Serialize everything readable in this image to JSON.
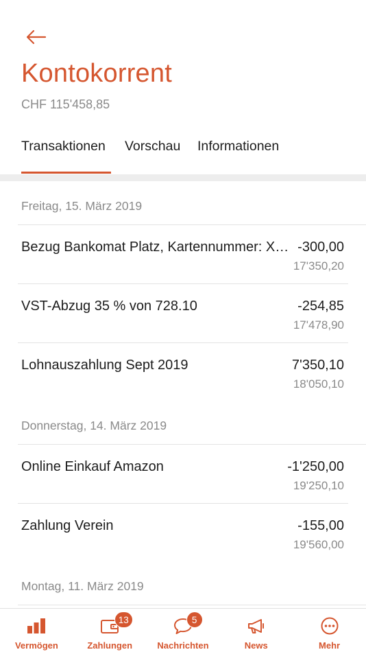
{
  "header": {
    "title": "Kontokorrent",
    "balance": "CHF 115'458,85"
  },
  "tabs": [
    {
      "label": "Transaktionen",
      "active": true
    },
    {
      "label": "Vorschau",
      "active": false
    },
    {
      "label": "Informationen",
      "active": false
    }
  ],
  "groups": [
    {
      "date": "Freitag, 15. März 2019",
      "transactions": [
        {
          "description": "Bezug Bankomat Platz, Kartennummer: XXXX",
          "amount": "-300,00",
          "balance": "17'350,20"
        },
        {
          "description": "VST-Abzug 35 % von 728.10",
          "amount": "-254,85",
          "balance": "17'478,90"
        },
        {
          "description": "Lohnauszahlung Sept 2019",
          "amount": "7'350,10",
          "balance": "18'050,10"
        }
      ]
    },
    {
      "date": "Donnerstag, 14. März 2019",
      "transactions": [
        {
          "description": "Online Einkauf Amazon",
          "amount": "-1'250,00",
          "balance": "19'250,10"
        },
        {
          "description": "Zahlung Verein",
          "amount": "-155,00",
          "balance": "19'560,00"
        }
      ]
    },
    {
      "date": "Montag, 11. März 2019",
      "transactions": []
    }
  ],
  "nav": [
    {
      "label": "Vermögen",
      "icon": "bar-chart-icon",
      "badge": ""
    },
    {
      "label": "Zahlungen",
      "icon": "wallet-icon",
      "badge": "13"
    },
    {
      "label": "Nachrichten",
      "icon": "chat-bubble-icon",
      "badge": "5"
    },
    {
      "label": "News",
      "icon": "megaphone-icon",
      "badge": ""
    },
    {
      "label": "Mehr",
      "icon": "more-icon",
      "badge": ""
    }
  ],
  "colors": {
    "accent": "#d5562f",
    "text": "#1c1c1c",
    "muted": "#8a8a8a",
    "divider": "#e3e3e3"
  }
}
